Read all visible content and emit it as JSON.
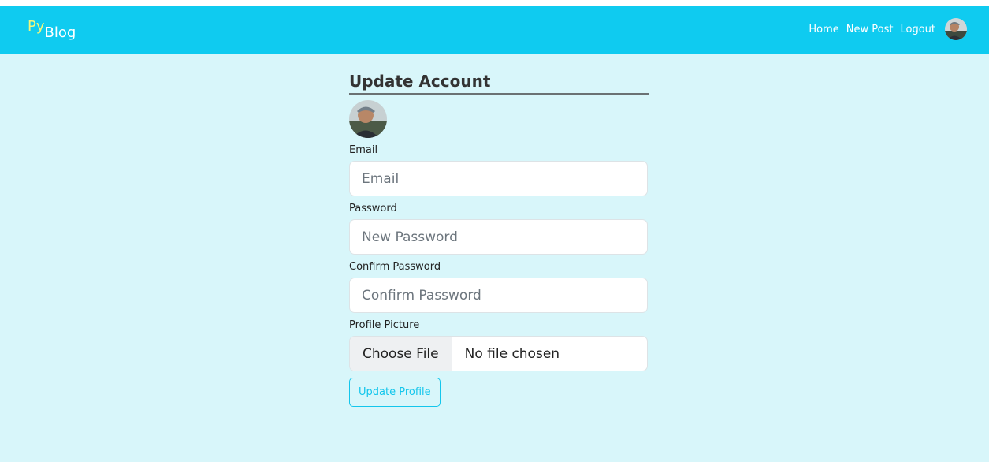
{
  "brand": {
    "prefix": "Py",
    "suffix": "Blog"
  },
  "nav": {
    "links": [
      "Home",
      "New Post",
      "Logout"
    ]
  },
  "form": {
    "title": "Update Account",
    "email": {
      "label": "Email",
      "placeholder": "Email",
      "value": ""
    },
    "password": {
      "label": "Password",
      "placeholder": "New Password",
      "value": ""
    },
    "confirm": {
      "label": "Confirm Password",
      "placeholder": "Confirm Password",
      "value": ""
    },
    "picture": {
      "label": "Profile Picture",
      "button": "Choose File",
      "status": "No file chosen"
    },
    "submit": "Update Profile"
  },
  "icons": {
    "nav_avatar": "user-avatar-icon",
    "profile_avatar": "profile-avatar-icon"
  },
  "colors": {
    "navbar": "#0fcbf0",
    "background": "#d8f6fa",
    "accent": "#13c6ec",
    "brand_prefix": "#f3f67a"
  }
}
